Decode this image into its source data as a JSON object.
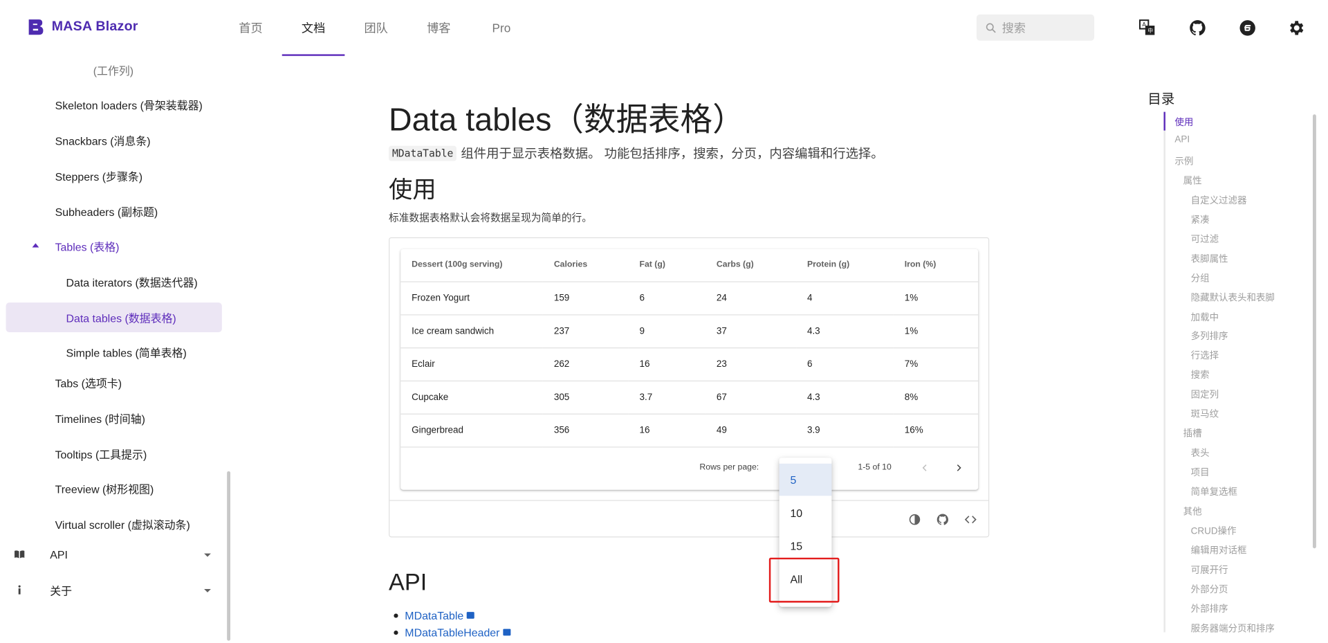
{
  "brand": {
    "name": "MASA Blazor",
    "color": "#5e2dbb"
  },
  "nav": [
    {
      "label": "首页",
      "active": false
    },
    {
      "label": "文档",
      "active": true
    },
    {
      "label": "团队",
      "active": false
    },
    {
      "label": "博客",
      "active": false
    },
    {
      "label": "Pro",
      "active": false
    }
  ],
  "search": {
    "placeholder": "搜索"
  },
  "header_icons": [
    "translate-icon",
    "github-icon",
    "gitee-icon",
    "settings-icon"
  ],
  "sidebar": {
    "items": [
      {
        "label": "(工作列)",
        "level": 1
      },
      {
        "label": "Skeleton loaders (骨架装载器)",
        "level": 1
      },
      {
        "label": "Snackbars (消息条)",
        "level": 1
      },
      {
        "label": "Steppers (步骤条)",
        "level": 1
      },
      {
        "label": "Subheaders (副标题)",
        "level": 1
      },
      {
        "label": "Tables (表格)",
        "level": 1,
        "expanded": true
      },
      {
        "label": "Data iterators (数据迭代器)",
        "level": 2
      },
      {
        "label": "Data tables (数据表格)",
        "level": 2,
        "selected": true
      },
      {
        "label": "Simple tables (简单表格)",
        "level": 2
      },
      {
        "label": "Tabs (选项卡)",
        "level": 1
      },
      {
        "label": "Timelines (时间轴)",
        "level": 1
      },
      {
        "label": "Tooltips (工具提示)",
        "level": 1
      },
      {
        "label": "Treeview (树形视图)",
        "level": 1
      },
      {
        "label": "Virtual scroller (虚拟滚动条)",
        "level": 1
      },
      {
        "label": "API",
        "level": 0,
        "icon": "book-icon"
      },
      {
        "label": "关于",
        "level": 0,
        "icon": "info-icon"
      }
    ]
  },
  "page": {
    "title": "Data tables（数据表格）",
    "intro_code": "MDataTable",
    "intro_text": "组件用于显示表格数据。 功能包括排序，搜索，分页，内容编辑和行选择。",
    "usage_heading": "使用",
    "usage_desc": "标准数据表格默认会将数据呈现为简单的行。",
    "api_heading": "API",
    "api_links": [
      "MDataTable",
      "MDataTableHeader"
    ]
  },
  "table": {
    "headers": [
      "Dessert (100g serving)",
      "Calories",
      "Fat (g)",
      "Carbs (g)",
      "Protein (g)",
      "Iron (%)"
    ],
    "rows": [
      [
        "Frozen Yogurt",
        "159",
        "6",
        "24",
        "4",
        "1%"
      ],
      [
        "Ice cream sandwich",
        "237",
        "9",
        "37",
        "4.3",
        "1%"
      ],
      [
        "Eclair",
        "262",
        "16",
        "23",
        "6",
        "7%"
      ],
      [
        "Cupcake",
        "305",
        "3.7",
        "67",
        "4.3",
        "8%"
      ],
      [
        "Gingerbread",
        "356",
        "16",
        "49",
        "3.9",
        "16%"
      ]
    ],
    "rows_per_page_label": "Rows per page:",
    "range_text": "1-5 of 10"
  },
  "rows_menu": {
    "options": [
      "5",
      "10",
      "15",
      "All"
    ],
    "selected": "5",
    "highlighted": "All"
  },
  "toc": {
    "title": "目录",
    "items": [
      {
        "label": "使用",
        "indent": 0,
        "active": true
      },
      {
        "label": "API",
        "indent": 0
      },
      {
        "label": "示例",
        "indent": 0
      },
      {
        "label": "属性",
        "indent": 1
      },
      {
        "label": "自定义过滤器",
        "indent": 2
      },
      {
        "label": "紧凑",
        "indent": 2
      },
      {
        "label": "可过滤",
        "indent": 2
      },
      {
        "label": "表脚属性",
        "indent": 2
      },
      {
        "label": "分组",
        "indent": 2
      },
      {
        "label": "隐藏默认表头和表脚",
        "indent": 2
      },
      {
        "label": "加载中",
        "indent": 2
      },
      {
        "label": "多列排序",
        "indent": 2
      },
      {
        "label": "行选择",
        "indent": 2
      },
      {
        "label": "搜索",
        "indent": 2
      },
      {
        "label": "固定列",
        "indent": 2
      },
      {
        "label": "斑马纹",
        "indent": 2
      },
      {
        "label": "插槽",
        "indent": 1
      },
      {
        "label": "表头",
        "indent": 2
      },
      {
        "label": "项目",
        "indent": 2
      },
      {
        "label": "简单复选框",
        "indent": 2
      },
      {
        "label": "其他",
        "indent": 1
      },
      {
        "label": "CRUD操作",
        "indent": 2
      },
      {
        "label": "编辑用对话框",
        "indent": 2
      },
      {
        "label": "可展开行",
        "indent": 2
      },
      {
        "label": "外部分页",
        "indent": 2
      },
      {
        "label": "外部排序",
        "indent": 2
      },
      {
        "label": "服务器端分页和排序",
        "indent": 2
      }
    ]
  }
}
